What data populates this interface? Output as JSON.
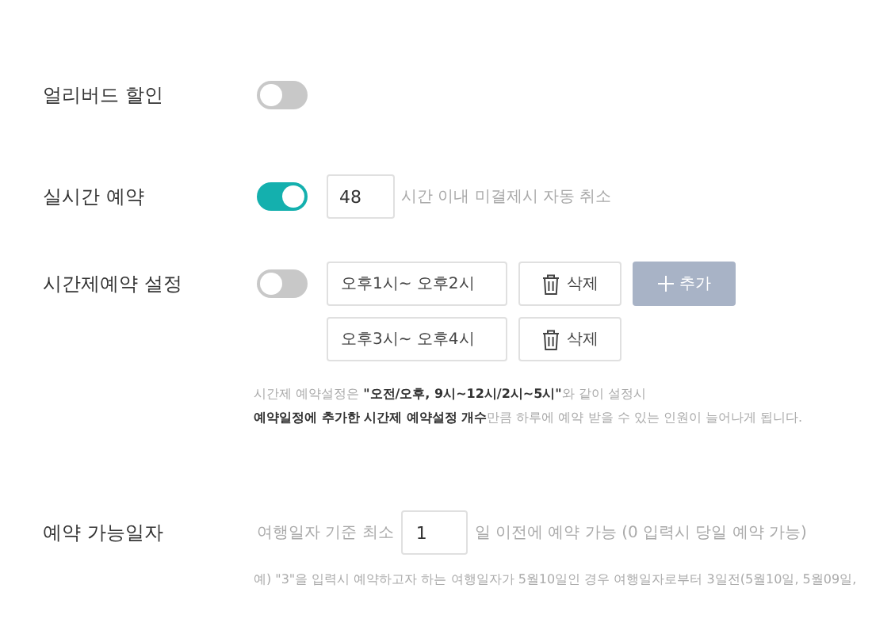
{
  "early_bird": {
    "label": "얼리버드 할인",
    "on": false
  },
  "realtime": {
    "label": "실시간 예약",
    "on": true,
    "hours": "48",
    "suffix": "시간 이내 미결제시 자동 취소"
  },
  "timeslot": {
    "label": "시간제예약 설정",
    "on": false,
    "add_button": "추가",
    "slots": [
      {
        "value": "오후1시~ 오후2시",
        "delete": "삭제"
      },
      {
        "value": "오후3시~ 오후4시",
        "delete": "삭제"
      }
    ],
    "notes": [
      "시간제 예약설정은 **\"오전/오후, 9시~12시/2시~5시\"**와 같이 설정시",
      "**예약일정에 추가한 시간제 예약설정 개수**만큼 하루에 예약 받을 수 있는 인원이 늘어나게 됩니다."
    ]
  },
  "available_date": {
    "label": "예약 가능일자",
    "prefix": "여행일자 기준 최소",
    "days": "1",
    "suffix": "일 이전에 예약 가능 (0 입력시 당일 예약 가능)",
    "example": "예) \"3\"을 입력시 예약하고자 하는 여행일자가 5월10일인 경우 여행일자로부터 3일전(5월10일, 5월09일,"
  }
}
